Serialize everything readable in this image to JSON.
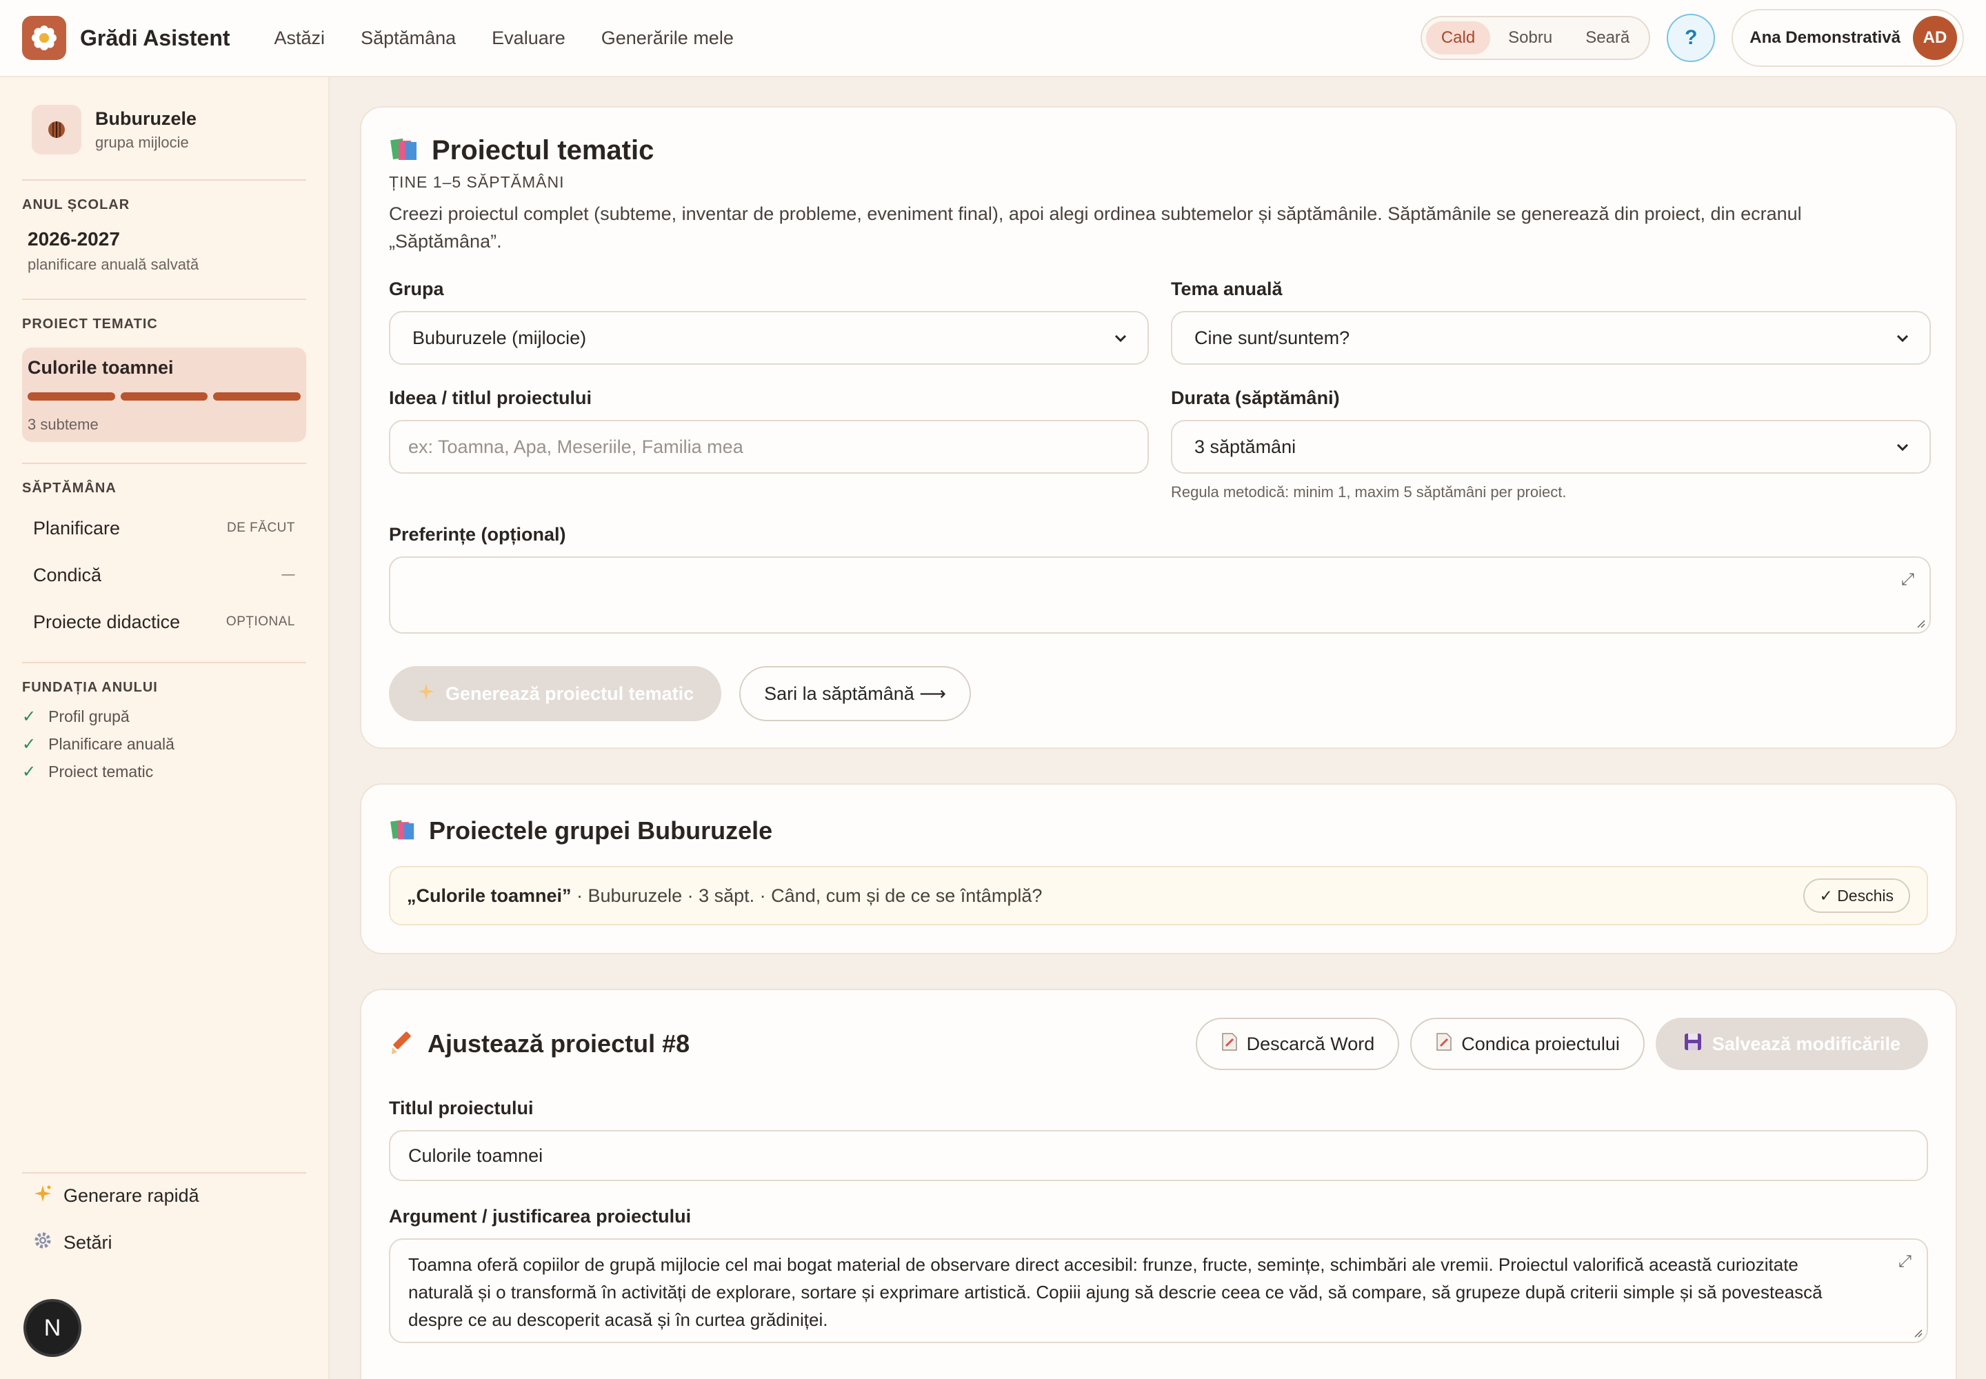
{
  "app": {
    "brand": "Grădi Asistent",
    "nav": [
      "Astăzi",
      "Săptămâna",
      "Evaluare",
      "Generările mele"
    ],
    "theme_options": [
      "Cald",
      "Sobru",
      "Seară"
    ],
    "theme_active": "Cald",
    "help_label": "?",
    "user_name": "Ana Demonstrativă",
    "user_initials": "AD",
    "accent_color": "#b8552f"
  },
  "sidebar": {
    "group_name": "Buburuzele",
    "group_sub": "grupa mijlocie",
    "year_title": "ANUL ȘCOLAR",
    "year_value": "2026-2027",
    "year_sub": "planificare anuală salvată",
    "project_title": "PROIECT TEMATIC",
    "project_name": "Culorile toamnei",
    "project_sub": "3 subteme",
    "project_progress_segments": 3,
    "week_title": "SĂPTĂMÂNA",
    "week_items": [
      {
        "label": "Planificare",
        "badge": "DE FĂCUT"
      },
      {
        "label": "Condică",
        "badge": "—"
      },
      {
        "label": "Proiecte didactice",
        "badge": "OPȚIONAL"
      }
    ],
    "foundation_title": "FUNDAȚIA ANULUI",
    "foundation_items": [
      "Profil grupă",
      "Planificare anuală",
      "Proiect tematic"
    ],
    "bottom_items": [
      {
        "label": "Generare rapidă",
        "icon": "sparkles-icon"
      },
      {
        "label": "Setări",
        "icon": "gear-icon"
      }
    ],
    "corner_badge": "N"
  },
  "project_form": {
    "title": "Proiectul tematic",
    "eyebrow": "ȚINE 1–5 SĂPTĂMÂNI",
    "description": "Creezi proiectul complet (subteme, inventar de probleme, eveniment final), apoi alegi ordinea subtemelor și săptămânile. Săptămânile se generează din proiect, din ecranul „Săptămâna”.",
    "group_label": "Grupa",
    "group_value": "Buburuzele (mijlocie)",
    "annual_theme_label": "Tema anuală",
    "annual_theme_value": "Cine sunt/suntem?",
    "idea_label": "Ideea / titlul proiectului",
    "idea_placeholder": "ex: Toamna, Apa, Meseriile, Familia mea",
    "duration_label": "Durata (săptămâni)",
    "duration_value": "3 săptămâni",
    "duration_hint": "Regula metodică: minim 1, maxim 5 săptămâni per proiect.",
    "preferences_label": "Preferințe (opțional)",
    "generate_button": "Generează proiectul tematic",
    "skip_button": "Sari la săptămână ⟶"
  },
  "group_projects": {
    "title": "Proiectele grupei Buburuzele",
    "project_title": "„Culorile toamnei”",
    "project_meta": " · Buburuzele · 3 săpt. · Când, cum și de ce se întâmplă?",
    "status": "✓ Deschis"
  },
  "adjust": {
    "title": "Ajustează proiectul #8",
    "download_word": "Descarcă Word",
    "project_log": "Condica proiectului",
    "save_changes": "Salvează modificările",
    "title_label": "Titlul proiectului",
    "title_value": "Culorile toamnei",
    "argument_label": "Argument / justificarea proiectului",
    "argument_value": "Toamna oferă copiilor de grupă mijlocie cel mai bogat material de observare direct accesibil: frunze, fructe, semințe, schimbări ale vremii. Proiectul valorifică această curiozitate naturală și o transformă în activități de explorare, sortare și exprimare artistică. Copiii ajung să descrie ceea ce văd, să compare, să grupeze după criterii simple și să povestească despre ce au descoperit acasă și în curtea grădiniței."
  }
}
